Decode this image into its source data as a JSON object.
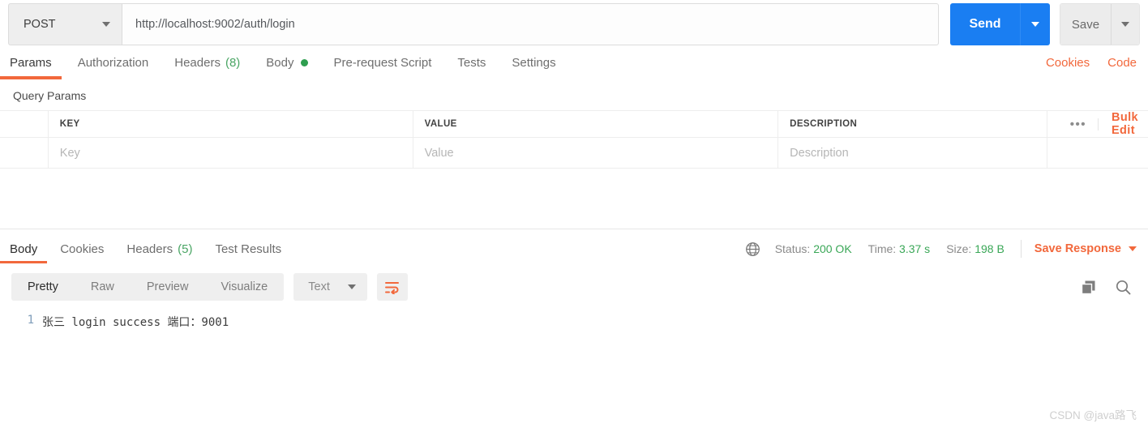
{
  "request": {
    "method": "POST",
    "url": "http://localhost:9002/auth/login",
    "send_label": "Send",
    "save_label": "Save",
    "tabs": [
      {
        "label": "Params",
        "active": true
      },
      {
        "label": "Authorization",
        "active": false
      },
      {
        "label": "Headers",
        "count": "(8)",
        "active": false
      },
      {
        "label": "Body",
        "dot": true,
        "active": false
      },
      {
        "label": "Pre-request Script",
        "active": false
      },
      {
        "label": "Tests",
        "active": false
      },
      {
        "label": "Settings",
        "active": false
      }
    ],
    "cookies_link": "Cookies",
    "code_link": "Code"
  },
  "params": {
    "section_title": "Query Params",
    "columns": [
      "KEY",
      "VALUE",
      "DESCRIPTION"
    ],
    "rows": [
      {
        "key": "Key",
        "value": "Value",
        "description": "Description"
      }
    ],
    "more_label": "•••",
    "bulk_edit_label": "Bulk Edit"
  },
  "response": {
    "tabs": [
      {
        "label": "Body",
        "active": true
      },
      {
        "label": "Cookies",
        "active": false
      },
      {
        "label": "Headers",
        "count": "(5)",
        "active": false
      },
      {
        "label": "Test Results",
        "active": false
      }
    ],
    "status_label": "Status:",
    "status_value": "200 OK",
    "time_label": "Time:",
    "time_value": "3.37 s",
    "size_label": "Size:",
    "size_value": "198 B",
    "save_response_label": "Save Response",
    "view_modes": [
      {
        "label": "Pretty",
        "active": true
      },
      {
        "label": "Raw",
        "active": false
      },
      {
        "label": "Preview",
        "active": false
      },
      {
        "label": "Visualize",
        "active": false
      }
    ],
    "format": "Text",
    "body_lines": [
      {
        "number": "1",
        "text": "张三 login success 端口：9001"
      }
    ]
  },
  "watermark": "CSDN @java路飞",
  "colors": {
    "accent_orange": "#f2683c",
    "send_blue": "#1a7ef2",
    "status_green": "#3aa757"
  }
}
